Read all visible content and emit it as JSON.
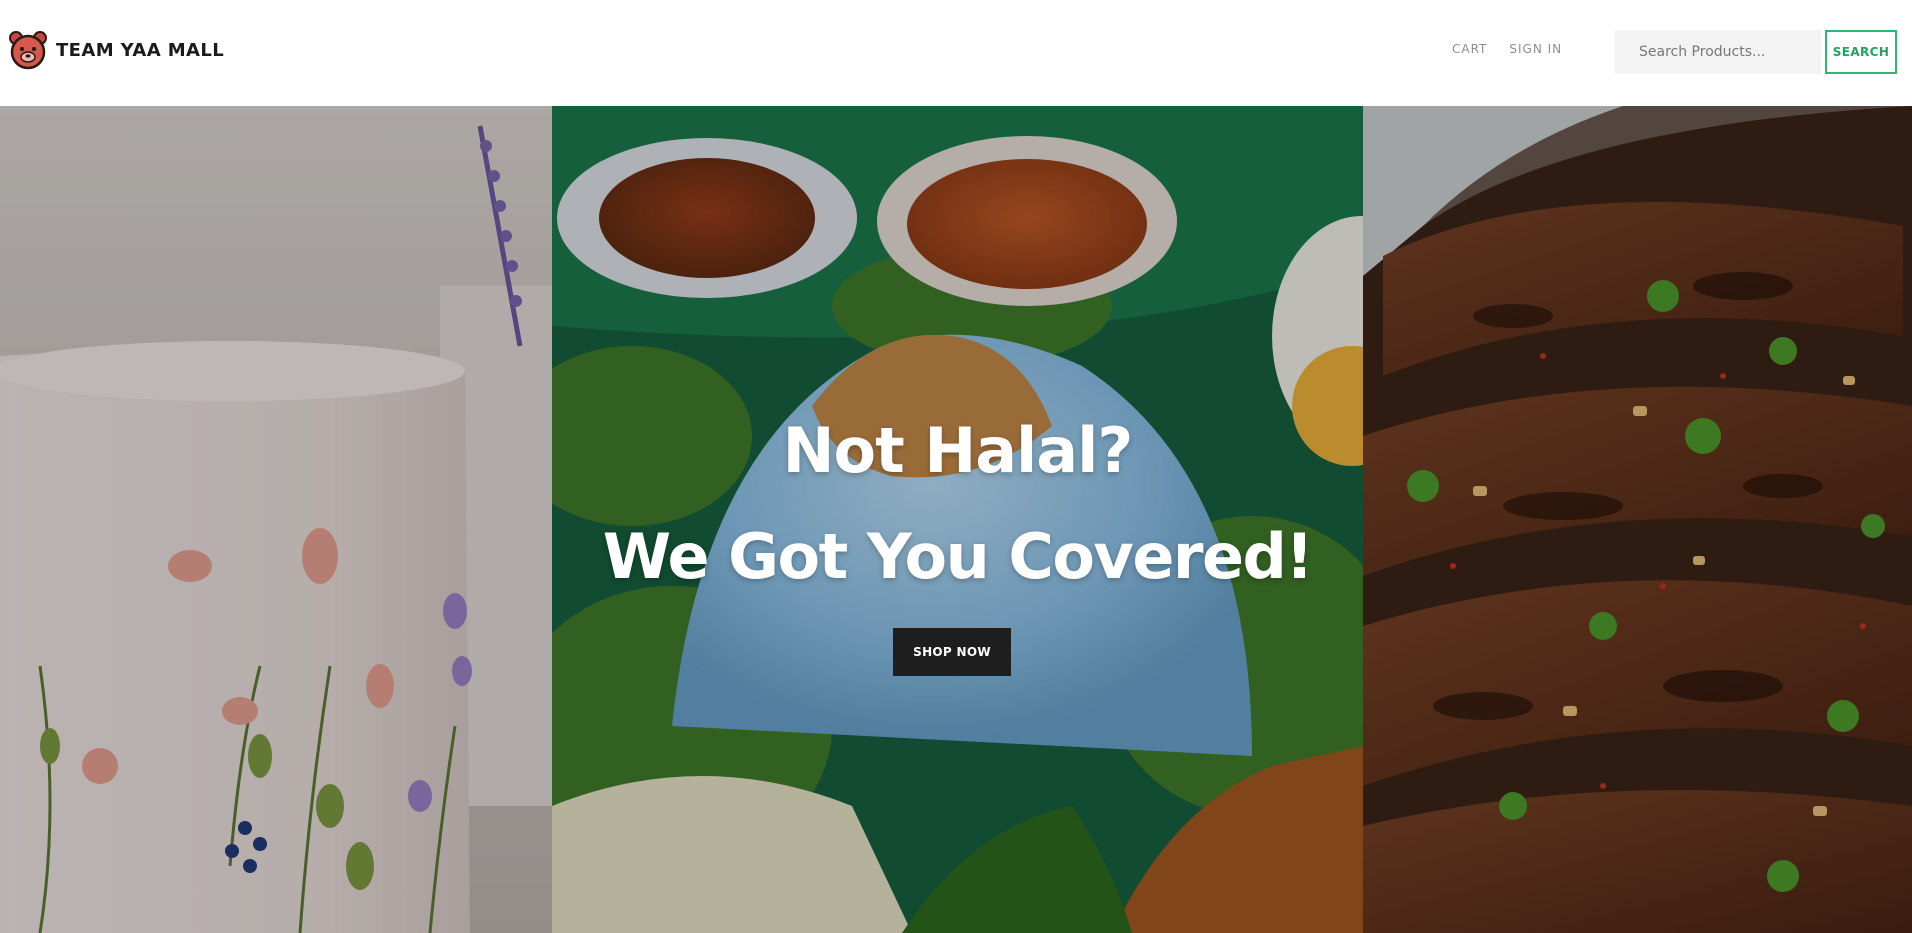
{
  "brand": {
    "name": "TEAM YAA MALL",
    "logo_icon": "bear-face-icon"
  },
  "nav": {
    "links": [
      {
        "label": "CART"
      },
      {
        "label": "SIGN IN"
      }
    ]
  },
  "search": {
    "placeholder": "Search Products...",
    "value": "",
    "button_label": "SEARCH"
  },
  "hero": {
    "headline_line1": "Not Halal?",
    "headline_line2": "We Got You Covered!",
    "cta_label": "SHOP NOW",
    "panels": [
      {
        "depicts": "cake-photo"
      },
      {
        "depicts": "nasi-lemak-photo"
      },
      {
        "depicts": "grilled-satay-photo"
      }
    ]
  },
  "colors": {
    "accent": "#2eb872",
    "cta_bg": "#1e1e1e",
    "nav_link": "#8e8e8e"
  }
}
